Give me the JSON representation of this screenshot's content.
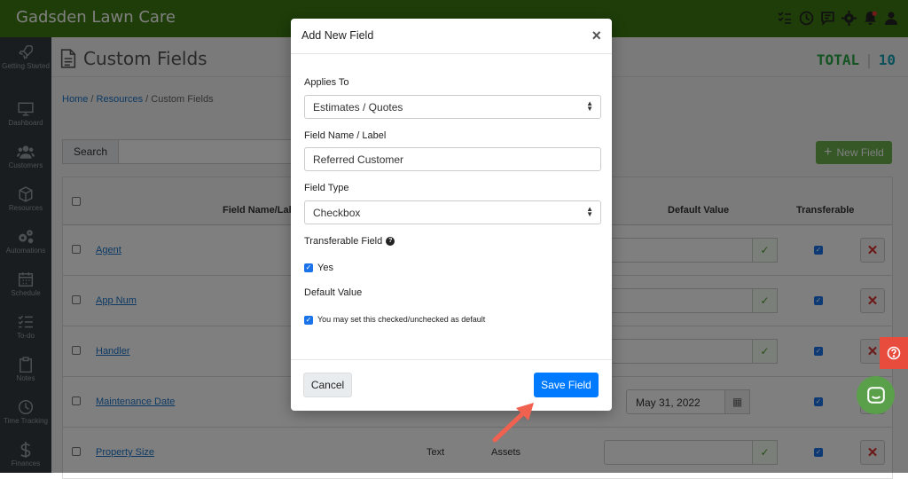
{
  "app": {
    "title": "Gadsden Lawn Care"
  },
  "topbar_icons": [
    "checklist-icon",
    "clock-icon",
    "chat-icon",
    "gear-icon",
    "bell-icon",
    "user-icon"
  ],
  "sidebar": {
    "items": [
      {
        "label": "Getting Started",
        "icon": "rocket-icon"
      },
      {
        "label": "Dashboard",
        "icon": "monitor-icon"
      },
      {
        "label": "Customers",
        "icon": "users-icon"
      },
      {
        "label": "Resources",
        "icon": "cube-icon"
      },
      {
        "label": "Automations",
        "icon": "gears-icon"
      },
      {
        "label": "Schedule",
        "icon": "calendar-icon"
      },
      {
        "label": "To-do",
        "icon": "list-icon"
      },
      {
        "label": "Notes",
        "icon": "clipboard-icon"
      },
      {
        "label": "Time Tracking",
        "icon": "clock-icon"
      },
      {
        "label": "Finances",
        "icon": "dollar-icon"
      }
    ]
  },
  "page": {
    "title": "Custom Fields",
    "total_label": "TOTAL",
    "total_value": "10",
    "breadcrumb": {
      "home": "Home",
      "resources": "Resources",
      "current": "Custom Fields",
      "sep": "/"
    },
    "search_label": "Search",
    "new_field_label": "New Field"
  },
  "table": {
    "columns": {
      "name": "Field Name/Label",
      "default": "Default Value",
      "transferable": "Transferable"
    },
    "rows": [
      {
        "name": "Agent",
        "type": "",
        "applies": "",
        "default": ""
      },
      {
        "name": "App Num",
        "type": "",
        "applies": "",
        "default": ""
      },
      {
        "name": "Handler",
        "type": "",
        "applies": "",
        "default": ""
      },
      {
        "name": "Maintenance Date",
        "type": "",
        "applies": "",
        "default": "May 31, 2022"
      },
      {
        "name": "Property Size",
        "type": "Text",
        "applies": "Assets",
        "default": ""
      }
    ]
  },
  "modal": {
    "title": "Add New Field",
    "close": "×",
    "applies_to_label": "Applies To",
    "applies_to_value": "Estimates / Quotes",
    "field_name_label": "Field Name / Label",
    "field_name_value": "Referred Customer",
    "field_type_label": "Field Type",
    "field_type_value": "Checkbox",
    "transferable_label": "Transferable Field",
    "yes_label": "Yes",
    "default_value_label": "Default Value",
    "default_hint": "You may set this checked/unchecked as default",
    "cancel_label": "Cancel",
    "save_label": "Save Field"
  },
  "colors": {
    "topbar": "#3d7a12",
    "primary": "#007bff",
    "success": "#6ab04c",
    "danger": "#d9302c"
  }
}
